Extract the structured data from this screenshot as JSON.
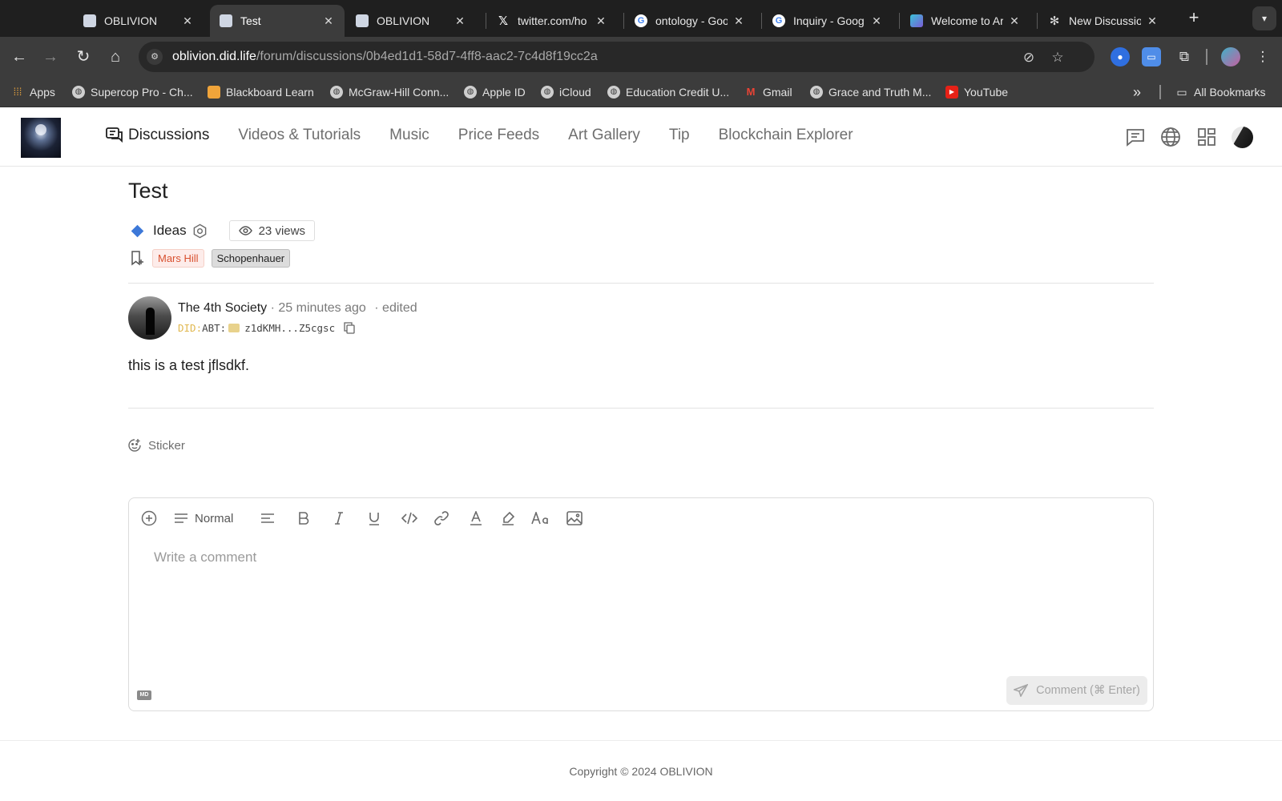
{
  "browser": {
    "tabs": [
      {
        "title": "OBLIVION",
        "icon": "oblivion-favicon",
        "active": false
      },
      {
        "title": "Test",
        "icon": "oblivion-favicon",
        "active": true
      },
      {
        "title": "OBLIVION",
        "icon": "oblivion-favicon",
        "active": false
      },
      {
        "title": "twitter.com/ho",
        "icon": "x-icon",
        "active": false
      },
      {
        "title": "ontology - Goo",
        "icon": "google-icon",
        "active": false
      },
      {
        "title": "Inquiry - Goog",
        "icon": "google-icon",
        "active": false
      },
      {
        "title": "Welcome to Ar",
        "icon": "arc-favicon",
        "active": false
      },
      {
        "title": "New Discussio",
        "icon": "openai-icon",
        "active": false
      }
    ],
    "url_host": "oblivion.did.life",
    "url_path": "/forum/discussions/0b4ed1d1-58d7-4ff8-aac2-7c4d8f19cc2a",
    "bookmarks": [
      {
        "label": "Apps",
        "icon": "apps-grid-icon"
      },
      {
        "label": "Supercop Pro - Ch...",
        "icon": "globe-icon"
      },
      {
        "label": "Blackboard Learn",
        "icon": "blackboard-icon"
      },
      {
        "label": "McGraw-Hill Conn...",
        "icon": "globe-icon"
      },
      {
        "label": "Apple ID",
        "icon": "globe-icon"
      },
      {
        "label": "iCloud",
        "icon": "globe-icon"
      },
      {
        "label": "Education Credit U...",
        "icon": "globe-icon"
      },
      {
        "label": "Gmail",
        "icon": "gmail-icon"
      },
      {
        "label": "Grace and Truth M...",
        "icon": "globe-icon"
      },
      {
        "label": "YouTube",
        "icon": "youtube-icon"
      }
    ],
    "more_bookmarks": "»",
    "all_bookmarks": "All Bookmarks"
  },
  "site": {
    "nav": {
      "discussions": "Discussions",
      "videos": "Videos & Tutorials",
      "music": "Music",
      "price_feeds": "Price Feeds",
      "art_gallery": "Art Gallery",
      "tip": "Tip",
      "explorer": "Blockchain Explorer"
    }
  },
  "post": {
    "title": "Test",
    "category": "Ideas",
    "views": "23 views",
    "tags": [
      "Mars Hill",
      "Schopenhauer"
    ],
    "author": "The 4th Society",
    "time": "· 25 minutes ago",
    "edited": "·  edited",
    "did_prefix": "DID:",
    "did_type": "ABT:",
    "did_short": "z1dKMH...Z5cgsc",
    "body": "this is a test jflsdkf."
  },
  "sticker_label": "Sticker",
  "editor": {
    "heading_style": "Normal",
    "placeholder": "Write a comment",
    "md_badge": "MD",
    "submit_label": "Comment (⌘ Enter)"
  },
  "footer": {
    "copyright": "Copyright © 2024 OBLIVION"
  },
  "colors": {
    "tag_red": "#d8502f",
    "category_diamond": "#3d78d8",
    "chrome_dark": "#1f1f1f",
    "chrome_toolbar": "#3c3c3c"
  }
}
